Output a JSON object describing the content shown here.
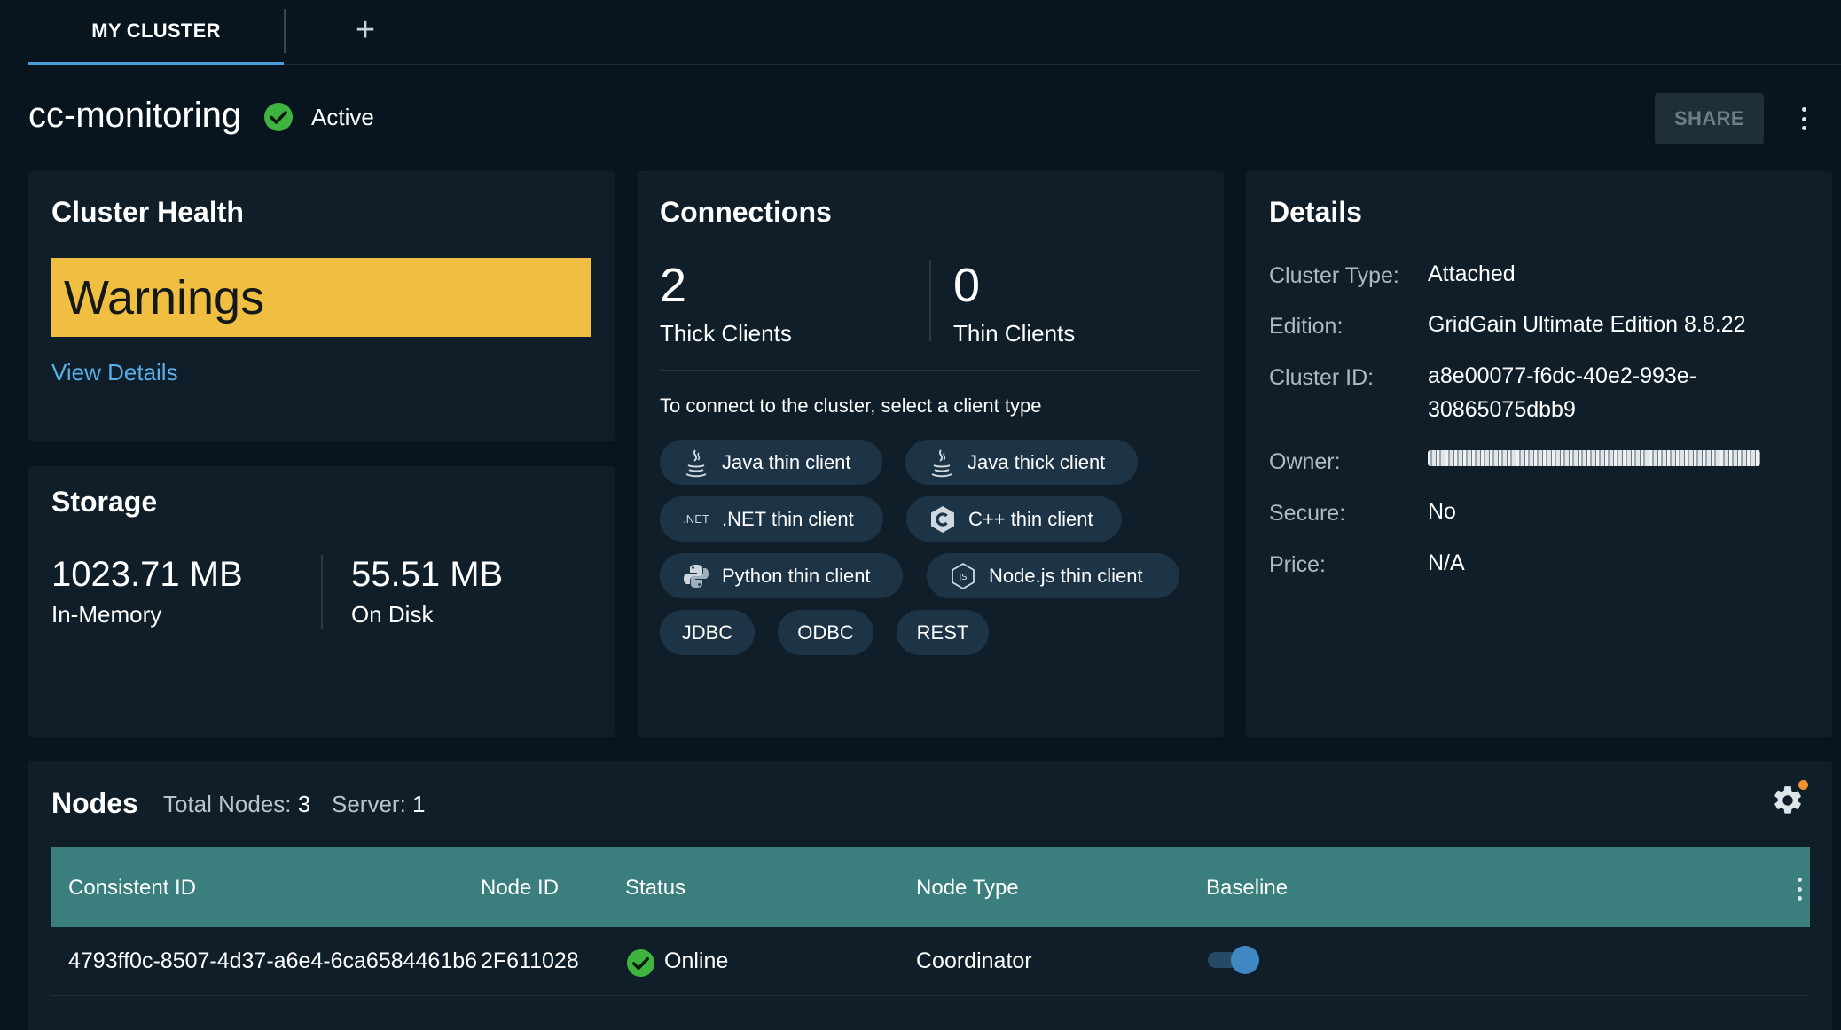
{
  "tabs": [
    {
      "label": "MY CLUSTER",
      "active": true
    }
  ],
  "tab_add_label": "+",
  "header": {
    "title": "cc-monitoring",
    "status": "Active",
    "status_color": "#3fb33f",
    "share_label": "SHARE"
  },
  "cluster_health": {
    "title": "Cluster Health",
    "state": "Warnings",
    "state_color": "#f0bf42",
    "link": "View Details"
  },
  "storage": {
    "title": "Storage",
    "stats": [
      {
        "value": "1023.71 MB",
        "label": "In-Memory"
      },
      {
        "value": "55.51 MB",
        "label": "On Disk"
      }
    ]
  },
  "connections": {
    "title": "Connections",
    "stats": [
      {
        "value": "2",
        "label": "Thick Clients"
      },
      {
        "value": "0",
        "label": "Thin Clients"
      }
    ],
    "hint": "To connect to the cluster, select a client type",
    "clients": [
      {
        "label": "Java thin client",
        "icon": "java-icon"
      },
      {
        "label": "Java thick client",
        "icon": "java-icon"
      },
      {
        "label": ".NET thin client",
        "icon": "dotnet-icon",
        "icon_text": ".NET"
      },
      {
        "label": "C++ thin client",
        "icon": "cpp-icon"
      },
      {
        "label": "Python thin client",
        "icon": "python-icon"
      },
      {
        "label": "Node.js thin client",
        "icon": "nodejs-icon"
      },
      {
        "label": "JDBC"
      },
      {
        "label": "ODBC"
      },
      {
        "label": "REST"
      }
    ]
  },
  "details": {
    "title": "Details",
    "rows": [
      {
        "key": "Cluster Type:",
        "value": "Attached"
      },
      {
        "key": "Edition:",
        "value": "GridGain Ultimate Edition 8.8.22"
      },
      {
        "key": "Cluster ID:",
        "value": "a8e00077-f6dc-40e2-993e-30865075dbb9"
      },
      {
        "key": "Owner:",
        "value": ""
      },
      {
        "key": "Secure:",
        "value": "No"
      },
      {
        "key": "Price:",
        "value": "N/A"
      }
    ]
  },
  "nodes": {
    "title": "Nodes",
    "total_label": "Total Nodes:",
    "total_value": "3",
    "server_label": "Server:",
    "server_value": "1",
    "columns": [
      "Consistent ID",
      "Node ID",
      "Status",
      "Node Type",
      "Baseline"
    ],
    "rows": [
      {
        "consistent_id": "4793ff0c-8507-4d37-a6e4-6ca6584461b6",
        "node_id": "2F611028",
        "status": "Online",
        "node_type": "Coordinator",
        "baseline": true
      }
    ],
    "header_color": "#3a7e7e",
    "settings_badge_color": "#f2922e"
  }
}
